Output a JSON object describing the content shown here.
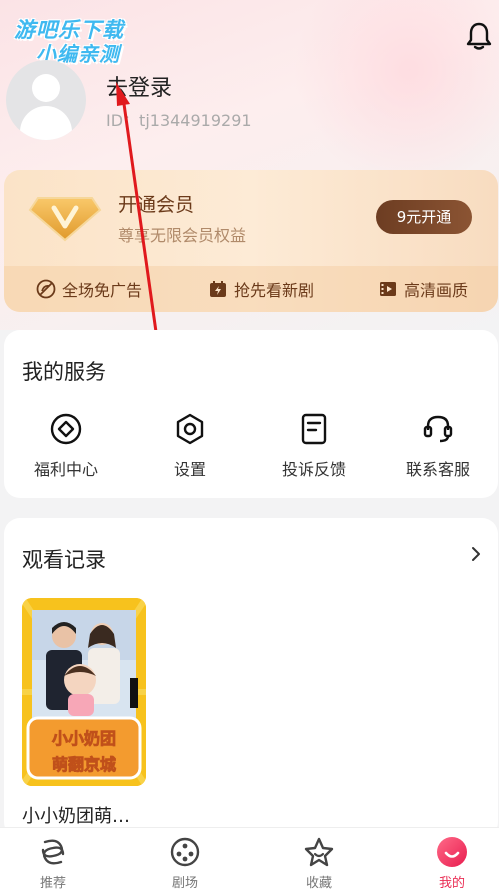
{
  "watermark": {
    "line1": "游吧乐下载",
    "line2": "小编亲测"
  },
  "profile": {
    "login_label": "去登录",
    "user_id": "ID：tj1344919291"
  },
  "vip": {
    "title": "开通会员",
    "subtitle": "尊享无限会员权益",
    "button": "9元开通",
    "features": [
      "全场免广告",
      "抢先看新剧",
      "高清画质"
    ]
  },
  "services": {
    "title": "我的服务",
    "items": [
      "福利中心",
      "设置",
      "投诉反馈",
      "联系客服"
    ]
  },
  "history": {
    "title": "观看记录",
    "items": [
      {
        "title": "小小奶团萌…",
        "poster_text_1": "小小奶团",
        "poster_text_2": "萌翻京城"
      }
    ]
  },
  "tabbar": {
    "items": [
      "推荐",
      "剧场",
      "收藏",
      "我的"
    ],
    "active": "我的"
  },
  "colors": {
    "accent": "#ea2e55",
    "vip_brown": "#6b3a1a",
    "watermark": "#3fb9f0"
  }
}
